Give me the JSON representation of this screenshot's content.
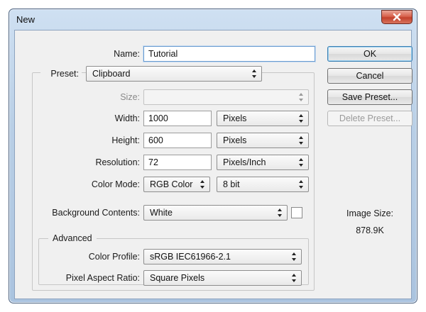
{
  "window": {
    "title": "New"
  },
  "form": {
    "name": {
      "label": "Name:",
      "value": "Tutorial"
    },
    "preset": {
      "label": "Preset:",
      "value": "Clipboard"
    },
    "size": {
      "label": "Size:",
      "value": ""
    },
    "width": {
      "label": "Width:",
      "value": "1000",
      "unit": "Pixels"
    },
    "height": {
      "label": "Height:",
      "value": "600",
      "unit": "Pixels"
    },
    "resolution": {
      "label": "Resolution:",
      "value": "72",
      "unit": "Pixels/Inch"
    },
    "color_mode": {
      "label": "Color Mode:",
      "value": "RGB Color",
      "depth": "8 bit"
    },
    "background": {
      "label": "Background Contents:",
      "value": "White",
      "swatch_color": "#ffffff"
    },
    "advanced": {
      "label": "Advanced",
      "color_profile": {
        "label": "Color Profile:",
        "value": "sRGB IEC61966-2.1"
      },
      "pixel_aspect": {
        "label": "Pixel Aspect Ratio:",
        "value": "Square Pixels"
      }
    }
  },
  "buttons": {
    "ok": "OK",
    "cancel": "Cancel",
    "save_preset": "Save Preset...",
    "delete_preset": "Delete Preset..."
  },
  "image_size": {
    "label": "Image Size:",
    "value": "878.9K"
  },
  "icons": {
    "close": "close-icon",
    "select_arrows": "updown-arrows-icon"
  }
}
